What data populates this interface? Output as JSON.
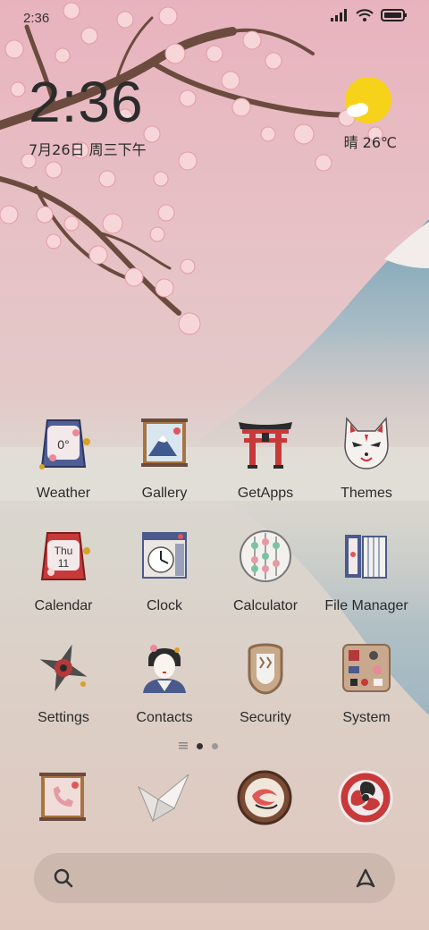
{
  "status_bar": {
    "time": "2:36"
  },
  "clock_widget": {
    "time": "2:36",
    "date": "7月26日 周三下午"
  },
  "weather_widget": {
    "text": "晴 26℃",
    "icon": "sun-icon"
  },
  "apps": [
    {
      "label": "Weather",
      "icon": "weather-charm-icon",
      "badge": "0°"
    },
    {
      "label": "Gallery",
      "icon": "fuji-scroll-icon"
    },
    {
      "label": "GetApps",
      "icon": "torii-gate-icon"
    },
    {
      "label": "Themes",
      "icon": "kitsune-mask-icon"
    },
    {
      "label": "Calendar",
      "icon": "calendar-charm-icon",
      "badge_day": "Thu",
      "badge_date": "11"
    },
    {
      "label": "Clock",
      "icon": "clock-scroll-icon"
    },
    {
      "label": "Calculator",
      "icon": "abacus-icon"
    },
    {
      "label": "File Manager",
      "icon": "scroll-folder-icon"
    },
    {
      "label": "Settings",
      "icon": "shuriken-icon"
    },
    {
      "label": "Contacts",
      "icon": "geisha-icon"
    },
    {
      "label": "Security",
      "icon": "rope-shield-icon"
    },
    {
      "label": "System",
      "icon": "tool-box-icon"
    }
  ],
  "dock": [
    {
      "icon": "phone-scroll-icon"
    },
    {
      "icon": "paper-crane-icon"
    },
    {
      "icon": "koi-camera-icon"
    },
    {
      "icon": "tomoe-browser-icon"
    }
  ],
  "page_indicator": {
    "pages": 2,
    "current": 1
  },
  "colors": {
    "accent_red": "#c8393a",
    "navy": "#4a5a8c",
    "wood": "#8b6a4f"
  }
}
